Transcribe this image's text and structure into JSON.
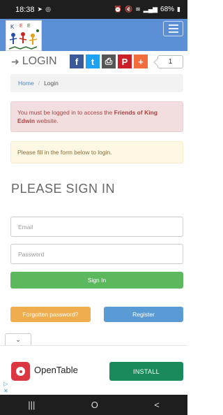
{
  "status_bar": {
    "time": "18:38",
    "battery": "68%"
  },
  "header": {
    "menu_icon": "hamburger-icon",
    "brand_color": "#5b8fd6"
  },
  "title_row": {
    "title": "LOGIN",
    "share_buttons": [
      {
        "name": "facebook",
        "glyph": "f",
        "color": "#3b5998"
      },
      {
        "name": "twitter",
        "glyph": "t",
        "color": "#1da1f2"
      },
      {
        "name": "print",
        "glyph": "⎙",
        "color": "#555555"
      },
      {
        "name": "pinterest",
        "glyph": "P",
        "color": "#cb2027"
      },
      {
        "name": "more",
        "glyph": "+",
        "color": "#f36c3d"
      }
    ],
    "share_count": "1"
  },
  "breadcrumb": {
    "home": "Home",
    "separator": "/",
    "current": "Login"
  },
  "alerts": {
    "danger_prefix": "You must be logged in to access the ",
    "danger_bold": "Friends of King Edwin",
    "danger_suffix": " website.",
    "warning": "Please fill in the form below to login."
  },
  "form": {
    "heading": "PLEASE SIGN IN",
    "email_placeholder": "Email",
    "password_placeholder": "Password",
    "signin_label": "Sign In",
    "forgot_label": "Forgotten password?",
    "register_label": "Register"
  },
  "ad": {
    "advertiser": "OpenTable",
    "cta": "INSTALL",
    "cta_color": "#1b8a5a",
    "logo_color": "#da3743"
  },
  "nav": {
    "recent": "|||",
    "home": "O",
    "back": "<"
  }
}
